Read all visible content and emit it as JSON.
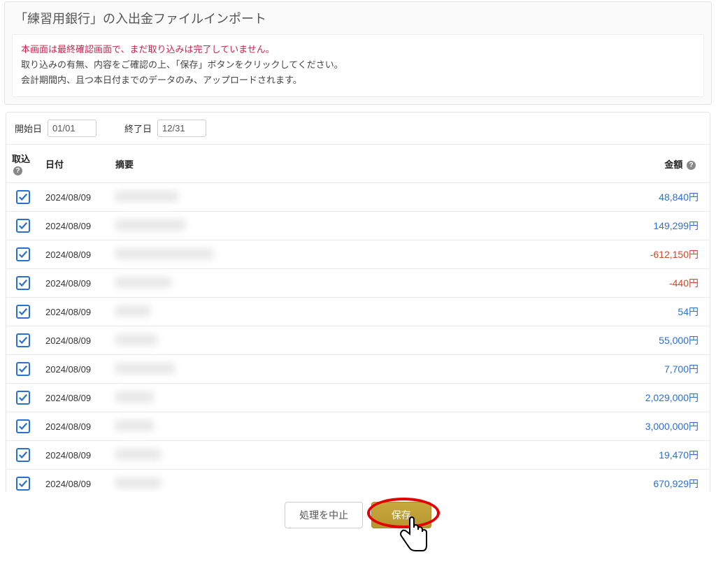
{
  "header": {
    "title": "「練習用銀行」の入出金ファイルインポート"
  },
  "notice": {
    "warn": "本画面は最終確認画面で、まだ取り込みは完了していません。",
    "line2": "取り込みの有無、内容をご確認の上、「保存」ボタンをクリックしてください。",
    "line3": "会計期間内、且つ本日付までのデータのみ、アップロードされます。"
  },
  "dates": {
    "start_label": "開始日",
    "start_value": "01/01",
    "end_label": "終了日",
    "end_value": "12/31"
  },
  "table": {
    "headers": {
      "import": "取込",
      "date": "日付",
      "desc": "摘要",
      "amount": "金額"
    },
    "rows": [
      {
        "checked": true,
        "date": "2024/08/09",
        "desc_width": 90,
        "amount": "48,840円",
        "neg": false
      },
      {
        "checked": true,
        "date": "2024/08/09",
        "desc_width": 100,
        "amount": "149,299円",
        "neg": false
      },
      {
        "checked": true,
        "date": "2024/08/09",
        "desc_width": 140,
        "amount": "-612,150円",
        "neg": true
      },
      {
        "checked": true,
        "date": "2024/08/09",
        "desc_width": 80,
        "amount": "-440円",
        "neg": true
      },
      {
        "checked": true,
        "date": "2024/08/09",
        "desc_width": 50,
        "amount": "54円",
        "neg": false
      },
      {
        "checked": true,
        "date": "2024/08/09",
        "desc_width": 60,
        "amount": "55,000円",
        "neg": false
      },
      {
        "checked": true,
        "date": "2024/08/09",
        "desc_width": 85,
        "amount": "7,700円",
        "neg": false
      },
      {
        "checked": true,
        "date": "2024/08/09",
        "desc_width": 55,
        "amount": "2,029,000円",
        "neg": false
      },
      {
        "checked": true,
        "date": "2024/08/09",
        "desc_width": 55,
        "amount": "3,000,000円",
        "neg": false
      },
      {
        "checked": true,
        "date": "2024/08/09",
        "desc_width": 65,
        "amount": "19,470円",
        "neg": false
      },
      {
        "checked": true,
        "date": "2024/08/09",
        "desc_width": 65,
        "amount": "670,929円",
        "neg": false
      }
    ]
  },
  "footer": {
    "cancel": "処理を中止",
    "save": "保存"
  }
}
